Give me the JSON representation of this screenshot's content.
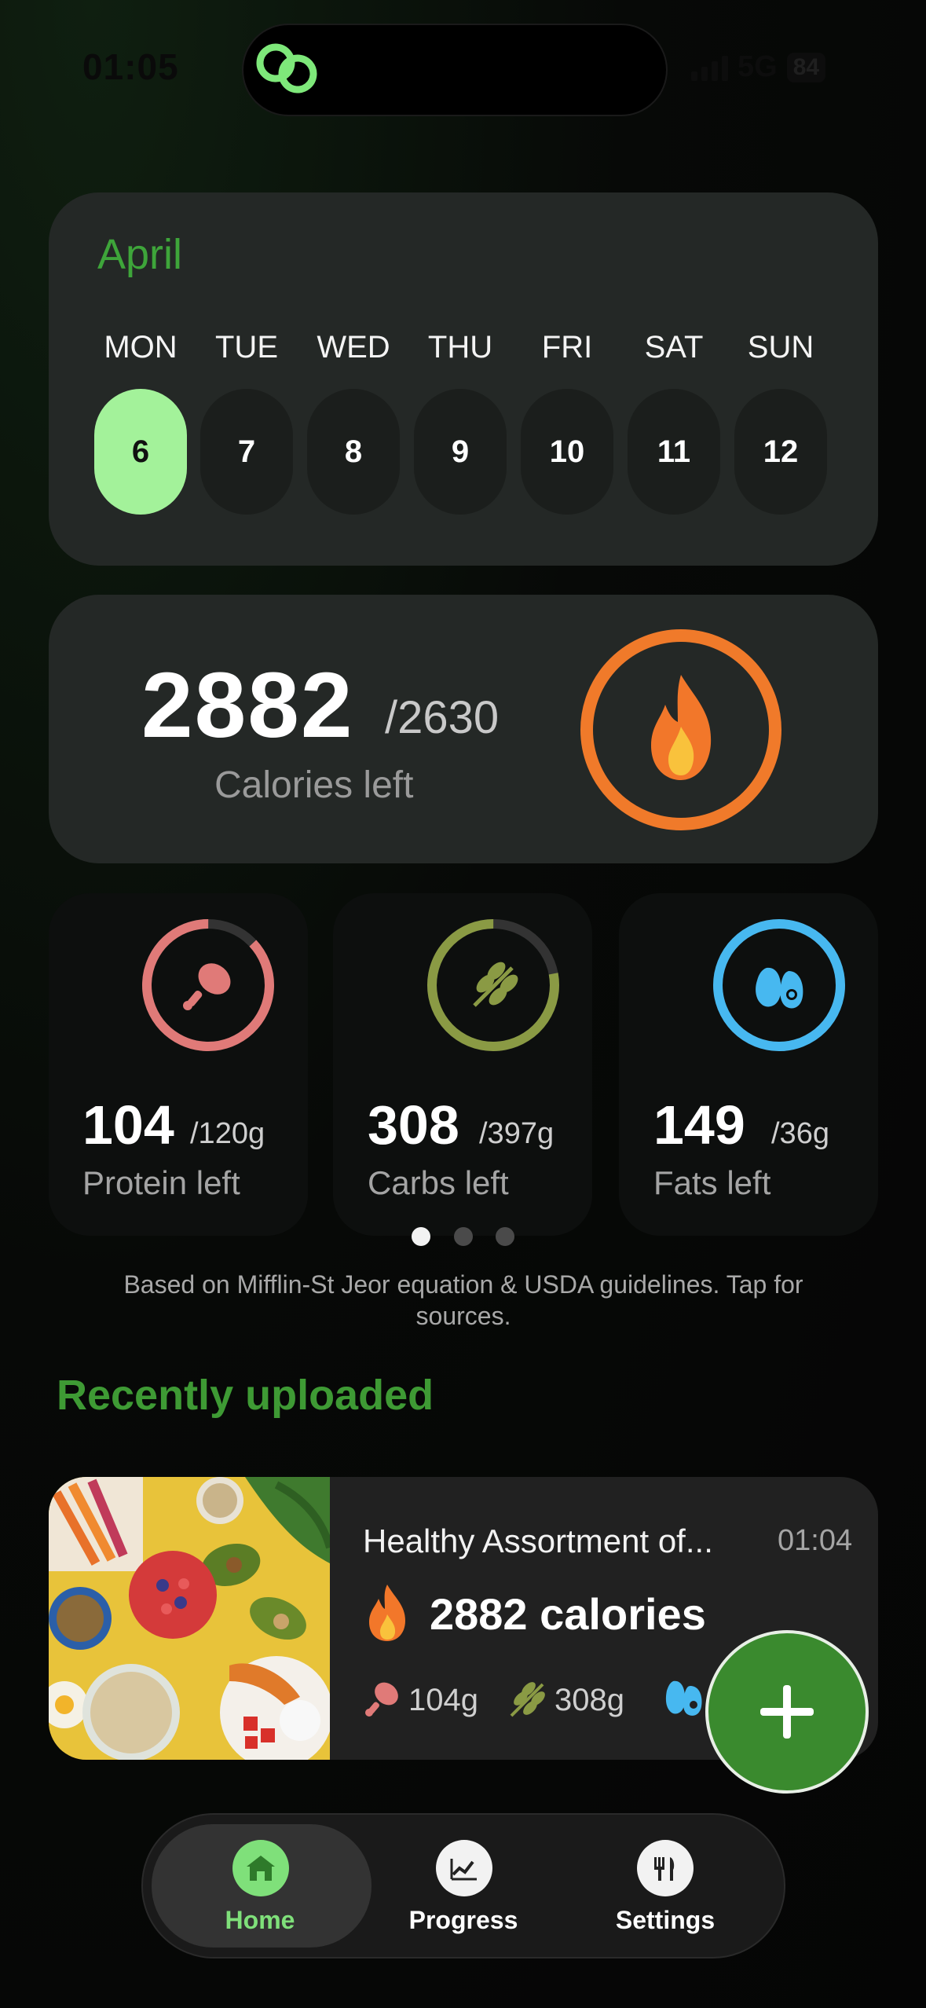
{
  "status_bar": {
    "time": "01:05",
    "network": "5G",
    "battery": "84"
  },
  "calendar": {
    "month": "April",
    "days": [
      {
        "name": "MON",
        "num": "6"
      },
      {
        "name": "TUE",
        "num": "7"
      },
      {
        "name": "WED",
        "num": "8"
      },
      {
        "name": "THU",
        "num": "9"
      },
      {
        "name": "FRI",
        "num": "10"
      },
      {
        "name": "SAT",
        "num": "11"
      },
      {
        "name": "SUN",
        "num": "12"
      }
    ]
  },
  "calories": {
    "left": "2882",
    "goal": "/2630",
    "label": "Calories left"
  },
  "macros": [
    {
      "value": "104",
      "goal": "/120g",
      "label": "Protein left",
      "icon": "drumstick-icon",
      "color": "#e07a78",
      "progress": 0.87
    },
    {
      "value": "308",
      "goal": "/397g",
      "label": "Carbs left",
      "icon": "wheat-icon",
      "color": "#8a9a44",
      "progress": 0.78
    },
    {
      "value": "149",
      "goal": "/36g",
      "label": "Fats left",
      "icon": "avocado-icon",
      "color": "#47b8f0",
      "progress": 1.0
    }
  ],
  "note": "Based on Mifflin-St Jeor equation & USDA guidelines. Tap for sources.",
  "recent": {
    "title": "Recently uploaded",
    "item": {
      "name": "Healthy Assortment of...",
      "time": "01:04",
      "calories": "2882 calories",
      "protein": "104g",
      "carbs": "308g"
    }
  },
  "nav": {
    "home": "Home",
    "progress": "Progress",
    "settings": "Settings"
  },
  "colors": {
    "accent_green": "#3e9a34",
    "active_day": "#a3f29a",
    "flame_ring": "#f07a2a"
  }
}
